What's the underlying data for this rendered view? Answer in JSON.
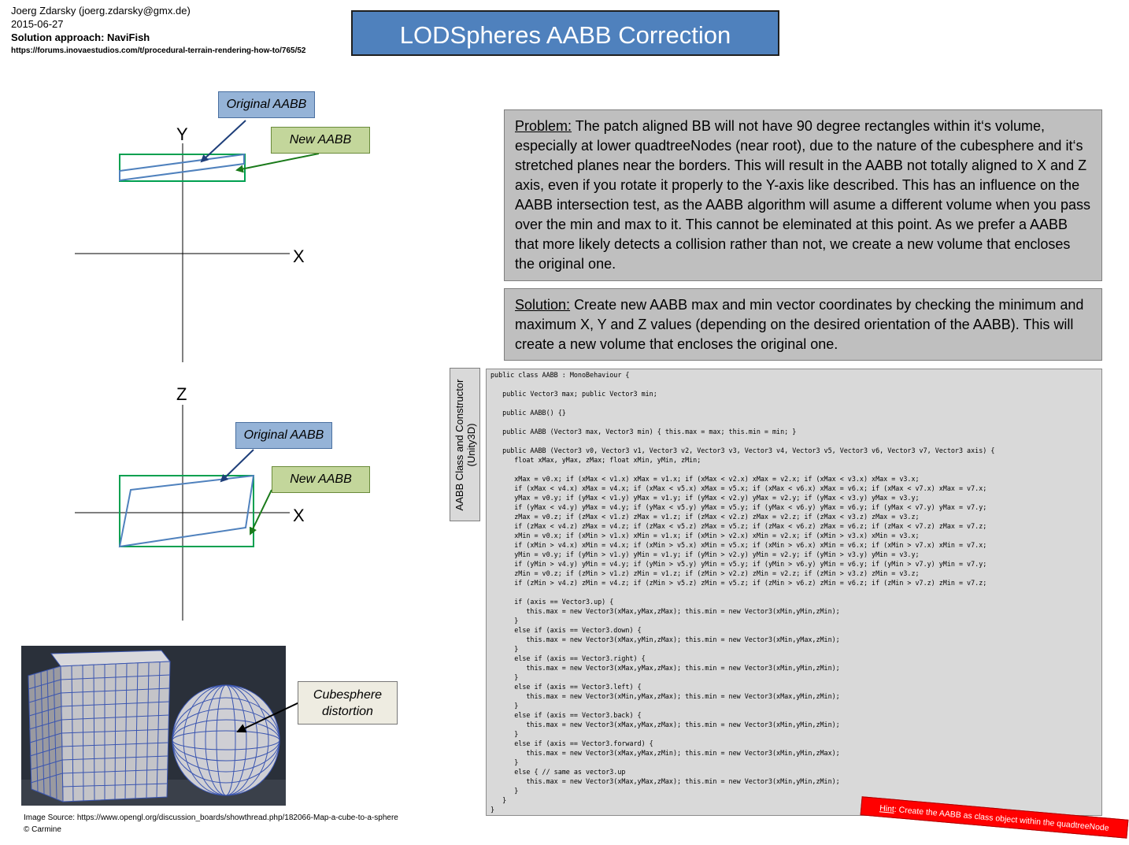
{
  "header": {
    "author": "Joerg Zdarsky  (joerg.zdarsky@gmx.de)",
    "date": "2015-06-27",
    "approach": "Solution approach: NaviFish",
    "url": "https://forums.inovaestudios.com/t/procedural-terrain-rendering-how-to/765/52"
  },
  "title": "LODSpheres AABB Correction",
  "diagram_top": {
    "axis_y": "Y",
    "axis_x": "X",
    "label_original": "Original AABB",
    "label_new": "New AABB"
  },
  "diagram_bottom": {
    "axis_z": "Z",
    "axis_x": "X",
    "label_original": "Original AABB",
    "label_new": "New AABB"
  },
  "cubesphere": {
    "label": "Cubesphere distortion",
    "caption_line1": "Image Source: https://www.opengl.org/discussion_boards/showthread.php/182066-Map-a-cube-to-a-sphere",
    "caption_line2": "© Carmine"
  },
  "problem": {
    "heading": "Problem:",
    "text": " The patch aligned BB will not have 90 degree rectangles within it‘s volume, especially at lower quadtreeNodes (near root), due to the nature of the cubesphere and it‘s stretched planes near the borders. This will result in the AABB not totally aligned to X and Z axis, even if you rotate it properly to the Y-axis like described. This has an influence on the AABB intersection test, as the AABB algorithm will asume a different volume when you pass over the min and max to it. This cannot be eleminated at this point. As we prefer a AABB that more likely detects a collision rather than not, we create a new volume that encloses the original one."
  },
  "solution": {
    "heading": "Solution:",
    "text": " Create new AABB max and min vector coordinates by checking the minimum and maximum X, Y and Z values (depending on the desired orientation of the AABB). This will create a new volume that encloses the original one."
  },
  "code_side_label": "AABB Class and Constructor\n(Unity3D)",
  "code": "public class AABB : MonoBehaviour {\n\n   public Vector3 max; public Vector3 min;\n\n   public AABB() {}\n\n   public AABB (Vector3 max, Vector3 min) { this.max = max; this.min = min; }\n\n   public AABB (Vector3 v0, Vector3 v1, Vector3 v2, Vector3 v3, Vector3 v4, Vector3 v5, Vector3 v6, Vector3 v7, Vector3 axis) {\n      float xMax, yMax, zMax; float xMin, yMin, zMin;\n\n      xMax = v0.x; if (xMax < v1.x) xMax = v1.x; if (xMax < v2.x) xMax = v2.x; if (xMax < v3.x) xMax = v3.x;\n      if (xMax < v4.x) xMax = v4.x; if (xMax < v5.x) xMax = v5.x; if (xMax < v6.x) xMax = v6.x; if (xMax < v7.x) xMax = v7.x;\n      yMax = v0.y; if (yMax < v1.y) yMax = v1.y; if (yMax < v2.y) yMax = v2.y; if (yMax < v3.y) yMax = v3.y;\n      if (yMax < v4.y) yMax = v4.y; if (yMax < v5.y) yMax = v5.y; if (yMax < v6.y) yMax = v6.y; if (yMax < v7.y) yMax = v7.y;\n      zMax = v0.z; if (zMax < v1.z) zMax = v1.z; if (zMax < v2.z) zMax = v2.z; if (zMax < v3.z) zMax = v3.z;\n      if (zMax < v4.z) zMax = v4.z; if (zMax < v5.z) zMax = v5.z; if (zMax < v6.z) zMax = v6.z; if (zMax < v7.z) zMax = v7.z;\n      xMin = v0.x; if (xMin > v1.x) xMin = v1.x; if (xMin > v2.x) xMin = v2.x; if (xMin > v3.x) xMin = v3.x;\n      if (xMin > v4.x) xMin = v4.x; if (xMin > v5.x) xMin = v5.x; if (xMin > v6.x) xMin = v6.x; if (xMin > v7.x) xMin = v7.x;\n      yMin = v0.y; if (yMin > v1.y) yMin = v1.y; if (yMin > v2.y) yMin = v2.y; if (yMin > v3.y) yMin = v3.y;\n      if (yMin > v4.y) yMin = v4.y; if (yMin > v5.y) yMin = v5.y; if (yMin > v6.y) yMin = v6.y; if (yMin > v7.y) yMin = v7.y;\n      zMin = v0.z; if (zMin > v1.z) zMin = v1.z; if (zMin > v2.z) zMin = v2.z; if (zMin > v3.z) zMin = v3.z;\n      if (zMin > v4.z) zMin = v4.z; if (zMin > v5.z) zMin = v5.z; if (zMin > v6.z) zMin = v6.z; if (zMin > v7.z) zMin = v7.z;\n\n      if (axis == Vector3.up) {\n         this.max = new Vector3(xMax,yMax,zMax); this.min = new Vector3(xMin,yMin,zMin);\n      }\n      else if (axis == Vector3.down) {\n         this.max = new Vector3(xMax,yMin,zMax); this.min = new Vector3(xMin,yMax,zMin);\n      }\n      else if (axis == Vector3.right) {\n         this.max = new Vector3(xMax,yMax,zMax); this.min = new Vector3(xMin,yMin,zMin);\n      }\n      else if (axis == Vector3.left) {\n         this.max = new Vector3(xMin,yMax,zMax); this.min = new Vector3(xMax,yMin,zMin);\n      }\n      else if (axis == Vector3.back) {\n         this.max = new Vector3(xMax,yMax,zMax); this.min = new Vector3(xMin,yMin,zMin);\n      }\n      else if (axis == Vector3.forward) {\n         this.max = new Vector3(xMax,yMax,zMin); this.min = new Vector3(xMin,yMin,zMax);\n      }\n      else { // same as vector3.up\n         this.max = new Vector3(xMax,yMax,zMax); this.min = new Vector3(xMin,yMin,zMin);\n      }\n   }\n}",
  "hint": {
    "heading": "Hint",
    "text": ": Create the AABB as class object within the quadtreeNode"
  },
  "colors": {
    "title_bg": "#4f81bd",
    "original_aabb": "#4f81bd",
    "new_aabb": "#00a050",
    "hint_bg": "#ff0000"
  }
}
